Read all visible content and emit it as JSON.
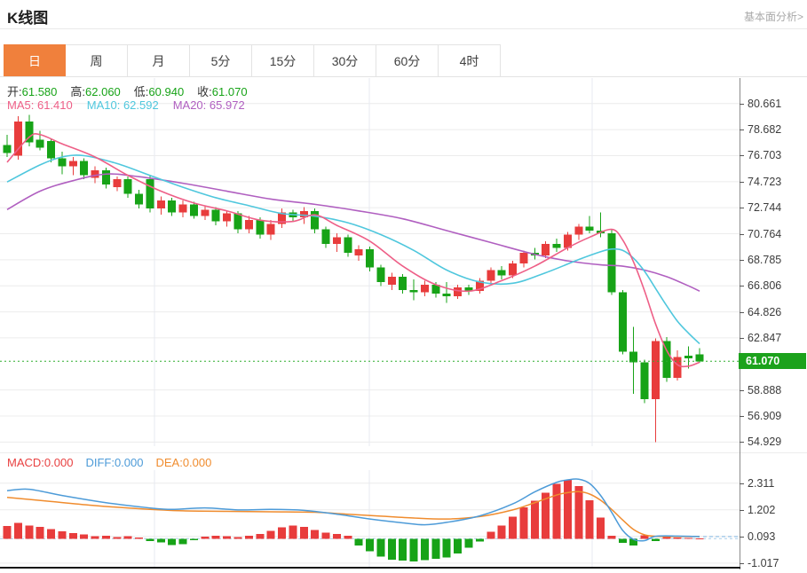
{
  "header": {
    "title": "K线图",
    "fundamental_link": "基本面分析>"
  },
  "tabs": [
    {
      "label": "日",
      "active": true
    },
    {
      "label": "周",
      "active": false
    },
    {
      "label": "月",
      "active": false
    },
    {
      "label": "5分",
      "active": false
    },
    {
      "label": "15分",
      "active": false
    },
    {
      "label": "30分",
      "active": false
    },
    {
      "label": "60分",
      "active": false
    },
    {
      "label": "4时",
      "active": false
    }
  ],
  "ohlc": {
    "open_label": "开:",
    "open": "61.580",
    "high_label": "高:",
    "high": "62.060",
    "low_label": "低:",
    "low": "60.940",
    "close_label": "收:",
    "close": "61.070"
  },
  "ma_legend": {
    "ma5_label": "MA5:",
    "ma5_value": "61.410",
    "ma10_label": "MA10:",
    "ma10_value": "62.592",
    "ma20_label": "MA20:",
    "ma20_value": "65.972"
  },
  "macd_legend": {
    "macd_label": "MACD:",
    "macd_value": "0.000",
    "diff_label": "DIFF:",
    "diff_value": "0.000",
    "dea_label": "DEA:",
    "dea_value": "0.000"
  },
  "colors": {
    "up": "#e83c3c",
    "down": "#17a317",
    "ma5": "#ee5f87",
    "ma10": "#4fc7dd",
    "ma20": "#b05fc0",
    "diff": "#4d9bd8",
    "dea": "#f08c2e",
    "text_green": "#17a317",
    "macd_text": "#e84040",
    "tag_bg": "#1ca21c",
    "current_line": "#2fae2f",
    "grid": "#ececec",
    "vgrid": "#e7eaf0",
    "zero_dash": "#a8cdea"
  },
  "chart_data": [
    {
      "type": "candlestick",
      "title": "K线图 (日K)",
      "legend": [
        "MA5",
        "MA10",
        "MA20"
      ],
      "y_ticks": [
        {
          "label": "80.661",
          "value": 80.661
        },
        {
          "label": "78.682",
          "value": 78.682
        },
        {
          "label": "76.703",
          "value": 76.703
        },
        {
          "label": "74.723",
          "value": 74.723
        },
        {
          "label": "72.744",
          "value": 72.744
        },
        {
          "label": "70.764",
          "value": 70.764
        },
        {
          "label": "68.785",
          "value": 68.785
        },
        {
          "label": "66.806",
          "value": 66.806
        },
        {
          "label": "64.826",
          "value": 64.826
        },
        {
          "label": "62.847",
          "value": 62.847
        },
        {
          "label": "58.888",
          "value": 58.888
        },
        {
          "label": "56.909",
          "value": 56.909
        },
        {
          "label": "54.929",
          "value": 54.929
        }
      ],
      "ylim": [
        54.5,
        82.6
      ],
      "current_price": {
        "label": "61.070",
        "value": 61.07
      },
      "x_gridlines": [
        174,
        416,
        667
      ],
      "candles_ohlc": [
        [
          77.5,
          78.3,
          76.6,
          76.9
        ],
        [
          76.7,
          79.7,
          76.4,
          79.3
        ],
        [
          79.3,
          79.8,
          77.4,
          77.7
        ],
        [
          77.9,
          78.6,
          77.1,
          77.3
        ],
        [
          77.8,
          78.0,
          76.2,
          76.5
        ],
        [
          76.5,
          77.0,
          75.3,
          75.9
        ],
        [
          75.9,
          76.6,
          75.2,
          76.3
        ],
        [
          76.3,
          76.5,
          74.9,
          75.2
        ],
        [
          75.0,
          75.9,
          74.6,
          75.6
        ],
        [
          75.6,
          75.8,
          74.2,
          74.5
        ],
        [
          74.3,
          75.1,
          74.0,
          74.9
        ],
        [
          74.9,
          75.1,
          73.5,
          73.8
        ],
        [
          73.8,
          74.1,
          72.7,
          73.0
        ],
        [
          74.9,
          75.2,
          72.4,
          72.7
        ],
        [
          72.7,
          73.6,
          72.2,
          73.3
        ],
        [
          73.3,
          73.5,
          72.1,
          72.4
        ],
        [
          72.4,
          73.3,
          72.0,
          73.0
        ],
        [
          73.0,
          73.2,
          71.9,
          72.1
        ],
        [
          72.1,
          72.9,
          71.8,
          72.6
        ],
        [
          72.6,
          72.8,
          71.4,
          71.7
        ],
        [
          71.7,
          72.5,
          71.3,
          72.3
        ],
        [
          72.3,
          72.5,
          70.8,
          71.1
        ],
        [
          71.1,
          72.1,
          70.8,
          71.8
        ],
        [
          71.8,
          72.0,
          70.4,
          70.7
        ],
        [
          70.7,
          71.8,
          70.3,
          71.5
        ],
        [
          71.5,
          72.7,
          71.2,
          72.4
        ],
        [
          72.4,
          72.6,
          71.7,
          72.0
        ],
        [
          72.0,
          72.8,
          71.5,
          72.5
        ],
        [
          72.5,
          72.7,
          70.8,
          71.1
        ],
        [
          71.1,
          71.3,
          69.7,
          70.0
        ],
        [
          70.0,
          70.8,
          69.4,
          70.5
        ],
        [
          70.5,
          70.7,
          69.0,
          69.3
        ],
        [
          69.1,
          69.9,
          68.7,
          69.6
        ],
        [
          69.6,
          69.8,
          67.9,
          68.2
        ],
        [
          68.2,
          68.4,
          66.8,
          67.1
        ],
        [
          66.9,
          67.8,
          66.5,
          67.5
        ],
        [
          67.5,
          67.7,
          66.2,
          66.5
        ],
        [
          66.5,
          67.3,
          65.7,
          66.3
        ],
        [
          66.3,
          67.2,
          66.0,
          66.9
        ],
        [
          66.9,
          67.1,
          65.9,
          66.2
        ],
        [
          66.2,
          67.1,
          65.5,
          66.0
        ],
        [
          66.0,
          66.9,
          65.8,
          66.7
        ],
        [
          66.7,
          66.9,
          66.1,
          66.4
        ],
        [
          66.4,
          67.4,
          66.2,
          67.2
        ],
        [
          67.2,
          68.2,
          67.0,
          68.0
        ],
        [
          68.0,
          68.3,
          67.3,
          67.6
        ],
        [
          67.6,
          68.7,
          67.4,
          68.5
        ],
        [
          68.5,
          69.5,
          68.2,
          69.3
        ],
        [
          69.3,
          69.7,
          68.8,
          69.1
        ],
        [
          69.1,
          70.2,
          68.9,
          70.0
        ],
        [
          70.0,
          70.4,
          69.4,
          69.7
        ],
        [
          69.7,
          70.9,
          69.5,
          70.7
        ],
        [
          70.7,
          71.5,
          70.3,
          71.3
        ],
        [
          71.3,
          72.1,
          70.8,
          71.0
        ],
        [
          71.0,
          72.4,
          70.5,
          70.8
        ],
        [
          70.8,
          71.1,
          66.1,
          66.3
        ],
        [
          66.3,
          66.5,
          61.6,
          61.8
        ],
        [
          61.8,
          63.7,
          58.6,
          61.0
        ],
        [
          61.0,
          61.2,
          57.9,
          58.2
        ],
        [
          58.2,
          62.8,
          54.93,
          62.6
        ],
        [
          62.6,
          62.9,
          59.5,
          59.8
        ],
        [
          59.8,
          61.9,
          59.6,
          61.4
        ],
        [
          61.5,
          62.2,
          60.5,
          61.3
        ],
        [
          61.58,
          62.06,
          60.94,
          61.07
        ]
      ],
      "ma5_points": [
        [
          0,
          76.2
        ],
        [
          2,
          78.1
        ],
        [
          3,
          78.3
        ],
        [
          5,
          77.6
        ],
        [
          8,
          76.6
        ],
        [
          11,
          75.2
        ],
        [
          14,
          74.0
        ],
        [
          17,
          73.1
        ],
        [
          20,
          72.5
        ],
        [
          23,
          71.8
        ],
        [
          26,
          71.7
        ],
        [
          28,
          72.2
        ],
        [
          30,
          71.4
        ],
        [
          33,
          70.2
        ],
        [
          36,
          68.3
        ],
        [
          39,
          66.9
        ],
        [
          42,
          66.4
        ],
        [
          45,
          67.2
        ],
        [
          48,
          68.3
        ],
        [
          51,
          69.7
        ],
        [
          53,
          70.5
        ],
        [
          55,
          71.1
        ],
        [
          56,
          70.3
        ],
        [
          57,
          68.6
        ],
        [
          58,
          66.4
        ],
        [
          59,
          63.9
        ],
        [
          60,
          61.9
        ],
        [
          61,
          60.8
        ],
        [
          62,
          60.7
        ],
        [
          63,
          61.0
        ]
      ],
      "ma10_points": [
        [
          0,
          74.7
        ],
        [
          3,
          76.0
        ],
        [
          5,
          76.6
        ],
        [
          7,
          76.7
        ],
        [
          10,
          76.1
        ],
        [
          13,
          75.2
        ],
        [
          16,
          74.3
        ],
        [
          19,
          73.5
        ],
        [
          22,
          72.9
        ],
        [
          25,
          72.3
        ],
        [
          28,
          72.1
        ],
        [
          31,
          71.6
        ],
        [
          34,
          70.7
        ],
        [
          37,
          69.5
        ],
        [
          40,
          68.0
        ],
        [
          43,
          67.1
        ],
        [
          46,
          67.0
        ],
        [
          49,
          67.8
        ],
        [
          52,
          68.8
        ],
        [
          54,
          69.4
        ],
        [
          55,
          69.6
        ],
        [
          56,
          69.5
        ],
        [
          57,
          68.9
        ],
        [
          58,
          67.9
        ],
        [
          59,
          66.6
        ],
        [
          60,
          65.3
        ],
        [
          61,
          64.1
        ],
        [
          62,
          63.2
        ],
        [
          63,
          62.4
        ]
      ],
      "ma20_points": [
        [
          0,
          72.6
        ],
        [
          3,
          74.0
        ],
        [
          6,
          74.8
        ],
        [
          9,
          75.3
        ],
        [
          12,
          75.1
        ],
        [
          16,
          74.6
        ],
        [
          20,
          74.0
        ],
        [
          24,
          73.4
        ],
        [
          28,
          73.0
        ],
        [
          32,
          72.5
        ],
        [
          36,
          71.9
        ],
        [
          40,
          71.0
        ],
        [
          44,
          70.1
        ],
        [
          48,
          69.2
        ],
        [
          51,
          68.7
        ],
        [
          54,
          68.4
        ],
        [
          56,
          68.3
        ],
        [
          58,
          68.0
        ],
        [
          60,
          67.5
        ],
        [
          62,
          66.8
        ],
        [
          63,
          66.4
        ]
      ]
    },
    {
      "type": "bar",
      "title": "MACD",
      "y_ticks": [
        {
          "label": "2.311",
          "value": 2.311
        },
        {
          "label": "1.202",
          "value": 1.202
        },
        {
          "label": "0.093",
          "value": 0.093
        },
        {
          "label": "-1.017",
          "value": -1.017
        }
      ],
      "ylim": [
        -1.32,
        2.86
      ],
      "x_gridlines": [
        174,
        416,
        667
      ],
      "histogram": [
        0.52,
        0.65,
        0.55,
        0.5,
        0.4,
        0.3,
        0.24,
        0.18,
        0.1,
        0.12,
        0.06,
        0.1,
        0.05,
        -0.1,
        -0.16,
        -0.26,
        -0.22,
        -0.06,
        0.08,
        0.12,
        0.1,
        0.06,
        0.12,
        0.2,
        0.32,
        0.48,
        0.55,
        0.5,
        0.36,
        0.26,
        0.2,
        0.12,
        -0.28,
        -0.52,
        -0.75,
        -0.88,
        -0.92,
        -0.95,
        -0.9,
        -0.84,
        -0.78,
        -0.62,
        -0.38,
        -0.12,
        0.28,
        0.55,
        0.92,
        1.3,
        1.58,
        1.92,
        2.28,
        2.45,
        2.2,
        1.6,
        0.88,
        0.12,
        -0.18,
        -0.28,
        0.14,
        -0.1,
        0.06,
        0.04,
        0.03,
        0.02
      ],
      "diff_points": [
        [
          0,
          2.0
        ],
        [
          2,
          2.06
        ],
        [
          5,
          1.8
        ],
        [
          9,
          1.5
        ],
        [
          13,
          1.28
        ],
        [
          15,
          1.22
        ],
        [
          18,
          1.28
        ],
        [
          21,
          1.2
        ],
        [
          24,
          1.22
        ],
        [
          27,
          1.18
        ],
        [
          30,
          1.02
        ],
        [
          33,
          0.82
        ],
        [
          36,
          0.66
        ],
        [
          38,
          0.58
        ],
        [
          40,
          0.68
        ],
        [
          43,
          0.95
        ],
        [
          46,
          1.45
        ],
        [
          48,
          1.95
        ],
        [
          50,
          2.35
        ],
        [
          51,
          2.45
        ],
        [
          52,
          2.48
        ],
        [
          53,
          2.3
        ],
        [
          54,
          1.8
        ],
        [
          55,
          1.1
        ],
        [
          56,
          0.35
        ],
        [
          57,
          -0.03
        ],
        [
          58,
          -0.08
        ],
        [
          59,
          0.1
        ],
        [
          61,
          0.11
        ],
        [
          63,
          0.09
        ]
      ],
      "dea_points": [
        [
          0,
          1.72
        ],
        [
          4,
          1.55
        ],
        [
          8,
          1.38
        ],
        [
          12,
          1.25
        ],
        [
          16,
          1.16
        ],
        [
          20,
          1.14
        ],
        [
          24,
          1.12
        ],
        [
          28,
          1.1
        ],
        [
          31,
          1.02
        ],
        [
          34,
          0.94
        ],
        [
          37,
          0.86
        ],
        [
          40,
          0.82
        ],
        [
          43,
          0.92
        ],
        [
          46,
          1.2
        ],
        [
          48,
          1.5
        ],
        [
          50,
          1.82
        ],
        [
          51,
          1.92
        ],
        [
          52,
          1.96
        ],
        [
          53,
          1.86
        ],
        [
          54,
          1.6
        ],
        [
          55,
          1.22
        ],
        [
          56,
          0.78
        ],
        [
          57,
          0.38
        ],
        [
          58,
          0.16
        ],
        [
          59,
          0.1
        ],
        [
          61,
          0.09
        ],
        [
          63,
          0.09
        ]
      ],
      "dashed_extension_value": 0.09
    }
  ]
}
